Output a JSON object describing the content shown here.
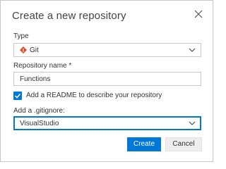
{
  "dialog": {
    "title": "Create a new repository",
    "type_label": "Type",
    "type_value": "Git",
    "repo_name_label": "Repository name *",
    "repo_name_value": "Functions",
    "readme_label": "Add a README to describe your repository",
    "readme_checked": true,
    "gitignore_label": "Add a .gitignore:",
    "gitignore_value": "VisualStudio",
    "create_label": "Create",
    "cancel_label": "Cancel"
  },
  "icons": {
    "close": "close-icon",
    "git": "git-icon",
    "chevron": "chevron-down-icon",
    "check": "checkmark-icon"
  },
  "colors": {
    "accent": "#0078d7",
    "git": "#e0472d"
  }
}
